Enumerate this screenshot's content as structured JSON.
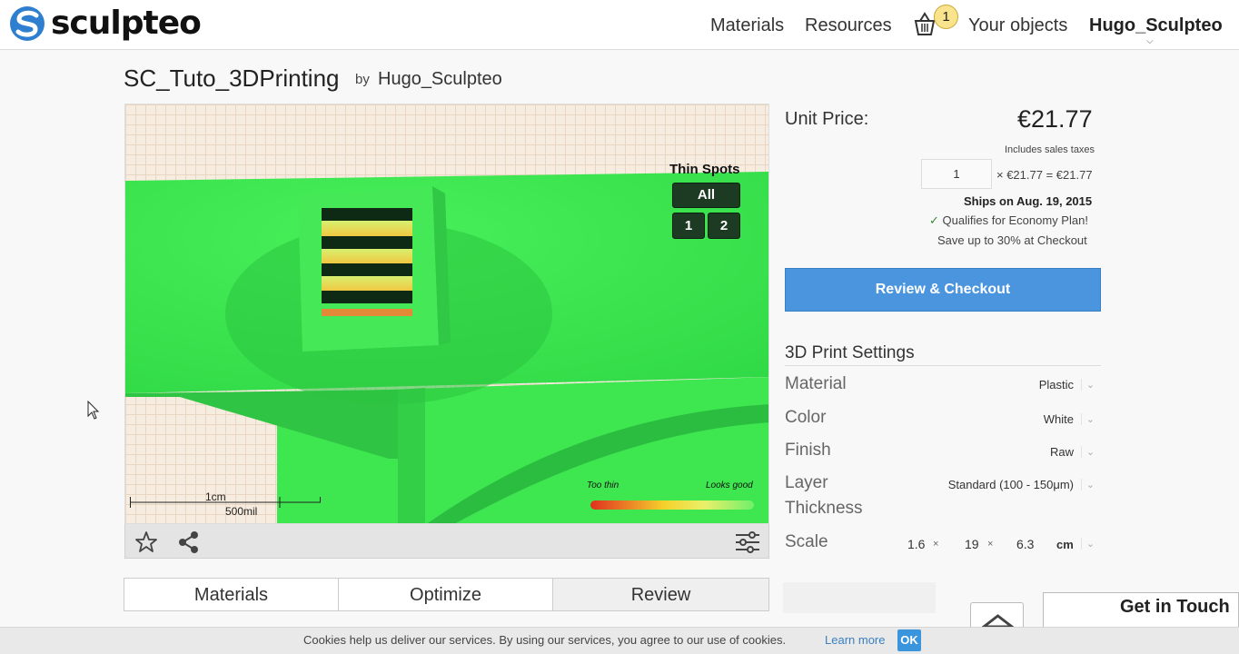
{
  "brand": {
    "name": "sculpteo"
  },
  "nav": {
    "materials": "Materials",
    "resources": "Resources",
    "basket_count": "1",
    "your_objects": "Your objects",
    "user": "Hugo_Sculpteo"
  },
  "object": {
    "title": "SC_Tuto_3DPrinting",
    "by": "by",
    "author": "Hugo_Sculpteo"
  },
  "viewer": {
    "thin_spots_title": "Thin Spots",
    "thin_spots_buttons": [
      "All",
      "1",
      "2"
    ],
    "legend_low": "Too thin",
    "legend_high": "Looks good",
    "scale_metric": "1cm",
    "scale_imperial": "500mil"
  },
  "tabs": [
    "Materials",
    "Optimize",
    "Review"
  ],
  "pricing": {
    "unit_label": "Unit Price:",
    "unit_price": "€21.77",
    "taxes_note": "Includes sales taxes",
    "quantity": "1",
    "quantity_calc": "× €21.77 = €21.77",
    "ships": "Ships on Aug. 19, 2015",
    "qualifies": "Qualifies for Economy Plan!",
    "save": "Save up to 30% at Checkout",
    "checkout_label": "Review & Checkout"
  },
  "settings": {
    "title": "3D Print Settings",
    "material_label": "Material",
    "material_value": "Plastic",
    "color_label": "Color",
    "color_value": "White",
    "finish_label": "Finish",
    "finish_value": "Raw",
    "layer_label_1": "Layer",
    "layer_label_2": "Thickness",
    "layer_value": "Standard (100 - 150μm)",
    "scale_label": "Scale",
    "scale_x": "1.6",
    "scale_y": "19",
    "scale_z": "6.3",
    "scale_times": "×",
    "scale_unit": "cm"
  },
  "footer": {
    "get_in_touch": "Get in Touch",
    "cookie_text": "Cookies help us deliver our services. By using our services, you agree to our use of cookies.",
    "cookie_link": "Learn more",
    "cookie_ok": "OK"
  },
  "colors": {
    "accent": "#4a95dd",
    "thin_spot_button": "#1c3b22",
    "model_green": "#3be84f"
  }
}
